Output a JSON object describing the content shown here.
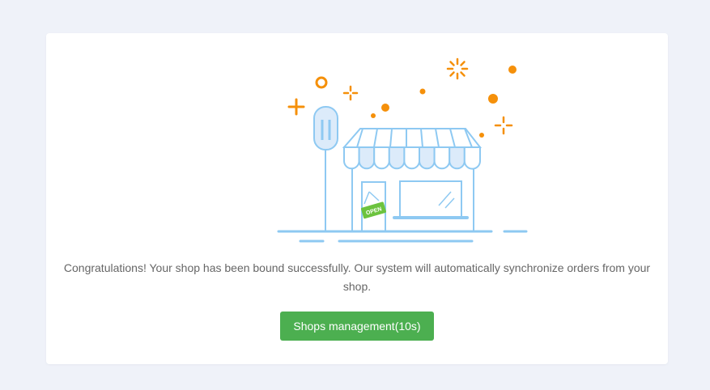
{
  "result": {
    "message": "Congratulations! Your shop has been bound successfully. Our system will automatically synchronize orders from your shop.",
    "button_label": "Shops management(10s)",
    "sign_label": "OPEN"
  },
  "colors": {
    "page_bg": "#eff2f9",
    "card_bg": "#ffffff",
    "illustration_line": "#8ec9f2",
    "illustration_fill": "#dcebfa",
    "sparkle": "#f5900a",
    "sign": "#6cc33e",
    "button": "#4caf50",
    "text": "#666666"
  },
  "icons": [
    "shop-storefront-illustration",
    "open-sign-icon",
    "sparkle-icon"
  ]
}
